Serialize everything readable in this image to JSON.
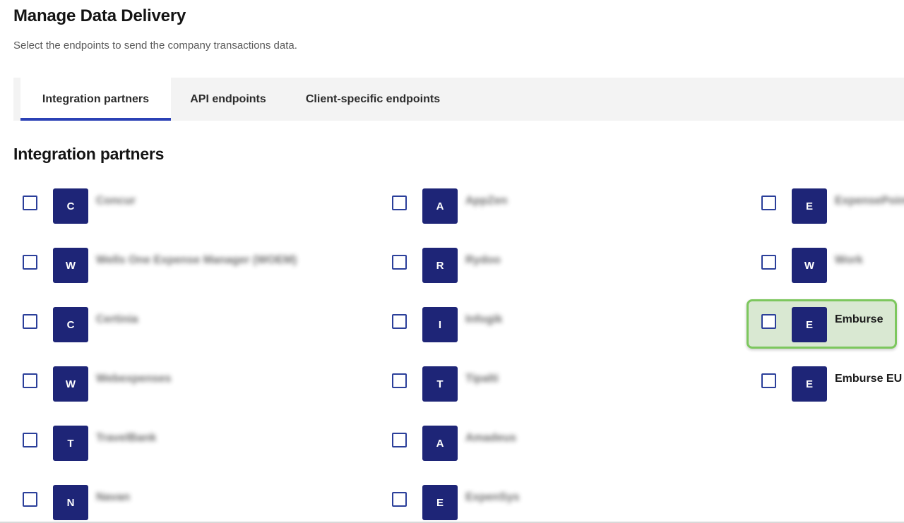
{
  "header": {
    "title": "Manage Data Delivery",
    "subtitle": "Select the endpoints to send the company transactions data."
  },
  "tabs": [
    {
      "label": "Integration partners",
      "active": true
    },
    {
      "label": "API endpoints",
      "active": false
    },
    {
      "label": "Client-specific endpoints",
      "active": false
    }
  ],
  "section": {
    "title": "Integration partners"
  },
  "partners": {
    "col1": [
      {
        "letter": "C",
        "name": "Concur",
        "checked": false,
        "blurred": true
      },
      {
        "letter": "W",
        "name": "Wells One Expense Manager (WOEM)",
        "checked": false,
        "blurred": true
      },
      {
        "letter": "C",
        "name": "Certinia",
        "checked": false,
        "blurred": true
      },
      {
        "letter": "W",
        "name": "Webexpenses",
        "checked": false,
        "blurred": true
      },
      {
        "letter": "T",
        "name": "TravelBank",
        "checked": false,
        "blurred": true
      },
      {
        "letter": "N",
        "name": "Navan",
        "checked": false,
        "blurred": true
      }
    ],
    "col2": [
      {
        "letter": "A",
        "name": "AppZen",
        "checked": false,
        "blurred": true
      },
      {
        "letter": "R",
        "name": "Rydoo",
        "checked": false,
        "blurred": true
      },
      {
        "letter": "I",
        "name": "Infogik",
        "checked": false,
        "blurred": true
      },
      {
        "letter": "T",
        "name": "Tipalti",
        "checked": false,
        "blurred": true
      },
      {
        "letter": "A",
        "name": "Amadeus",
        "checked": false,
        "blurred": true
      },
      {
        "letter": "E",
        "name": "ExpenSys",
        "checked": false,
        "blurred": true
      }
    ],
    "col3": [
      {
        "letter": "E",
        "name": "ExpensePoint",
        "checked": false,
        "blurred": true
      },
      {
        "letter": "W",
        "name": "Work",
        "checked": false,
        "blurred": true
      },
      {
        "letter": "E",
        "name": "Emburse",
        "checked": false,
        "blurred": false,
        "highlighted": true
      },
      {
        "letter": "E",
        "name": "Emburse EU",
        "checked": false,
        "blurred": false
      }
    ]
  },
  "colors": {
    "accent": "#2b41b5",
    "logo_bg": "#1e2577",
    "highlight": "#7dc75e"
  }
}
